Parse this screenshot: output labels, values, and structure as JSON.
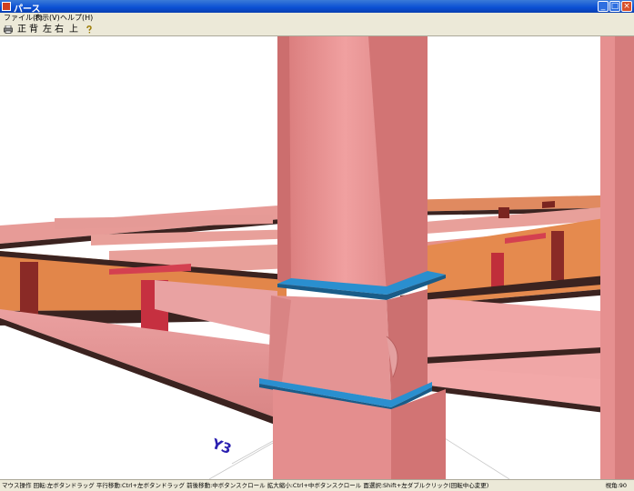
{
  "window": {
    "title": "パース",
    "minimize_glyph": "_",
    "maximize_glyph": "□",
    "close_glyph": "×"
  },
  "menu": {
    "items": [
      {
        "label": "ファイル(F)"
      },
      {
        "label": "表示(V)"
      },
      {
        "label": "ヘルプ(H)"
      }
    ]
  },
  "toolbar": {
    "print_icon": "printer-icon",
    "help_icon": "question-icon",
    "views": [
      {
        "label": "正"
      },
      {
        "label": "背"
      },
      {
        "label": "左"
      },
      {
        "label": "右"
      },
      {
        "label": "上"
      }
    ]
  },
  "viewport": {
    "axis_label": "Y3"
  },
  "status": {
    "mouse_help": "マウス操作  回転:左ボタンドラッグ  平行移動:Ctrl+左ボタンドラッグ  前後移動:中ボタンスクロール  拡大縮小:Ctrl+中ボタンスクロール  面選択:Shift+左ダブルクリック(回転中心変更)",
    "view_angle": "視角:90"
  },
  "colors": {
    "column": "#e58686",
    "beam_web": "#d97a72",
    "girder_orange": "#e8874a",
    "plate_blue": "#2a8fcf",
    "stiffener_red": "#c2303f",
    "dark_edge": "#3a2220",
    "axis_label": "#2a1fb0"
  }
}
